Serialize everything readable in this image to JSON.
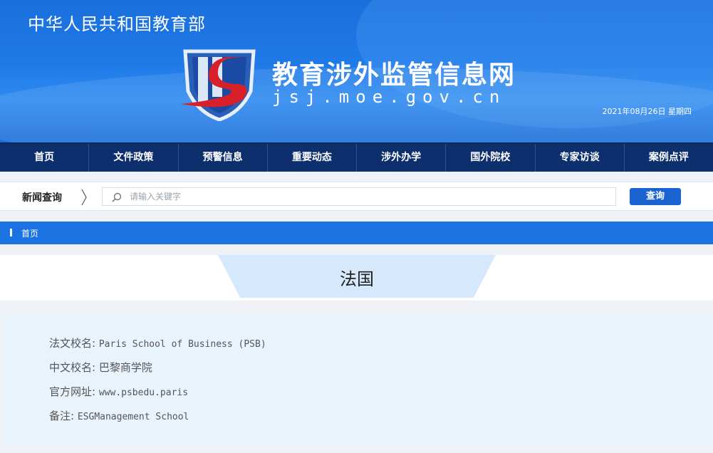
{
  "header": {
    "ministry": "中华人民共和国教育部",
    "site_name": "教育涉外监管信息网",
    "domain": "jsj.moe.gov.cn",
    "date": "2021年08月26日 星期四"
  },
  "nav": {
    "items": [
      "首页",
      "文件政策",
      "预警信息",
      "重要动态",
      "涉外办学",
      "国外院校",
      "专家访谈",
      "案例点评"
    ]
  },
  "search": {
    "label": "新闻查询",
    "placeholder": "请输入关键字",
    "button": "查询"
  },
  "breadcrumb": {
    "home": "首页"
  },
  "page": {
    "title": "法国"
  },
  "school": {
    "rows": [
      {
        "label": "法文校名:",
        "value": "Paris School of Business (PSB)"
      },
      {
        "label": "中文校名:",
        "value": "巴黎商学院"
      },
      {
        "label": "官方网址:",
        "value": "www.psbedu.paris"
      },
      {
        "label": "备注:",
        "value": "ESGManagement School"
      }
    ]
  },
  "colors": {
    "banner": "#1f7ae8",
    "nav": "#0d2f6e",
    "accent": "#1a73e0",
    "button": "#1b63d1",
    "logo_red": "#d8202a"
  }
}
